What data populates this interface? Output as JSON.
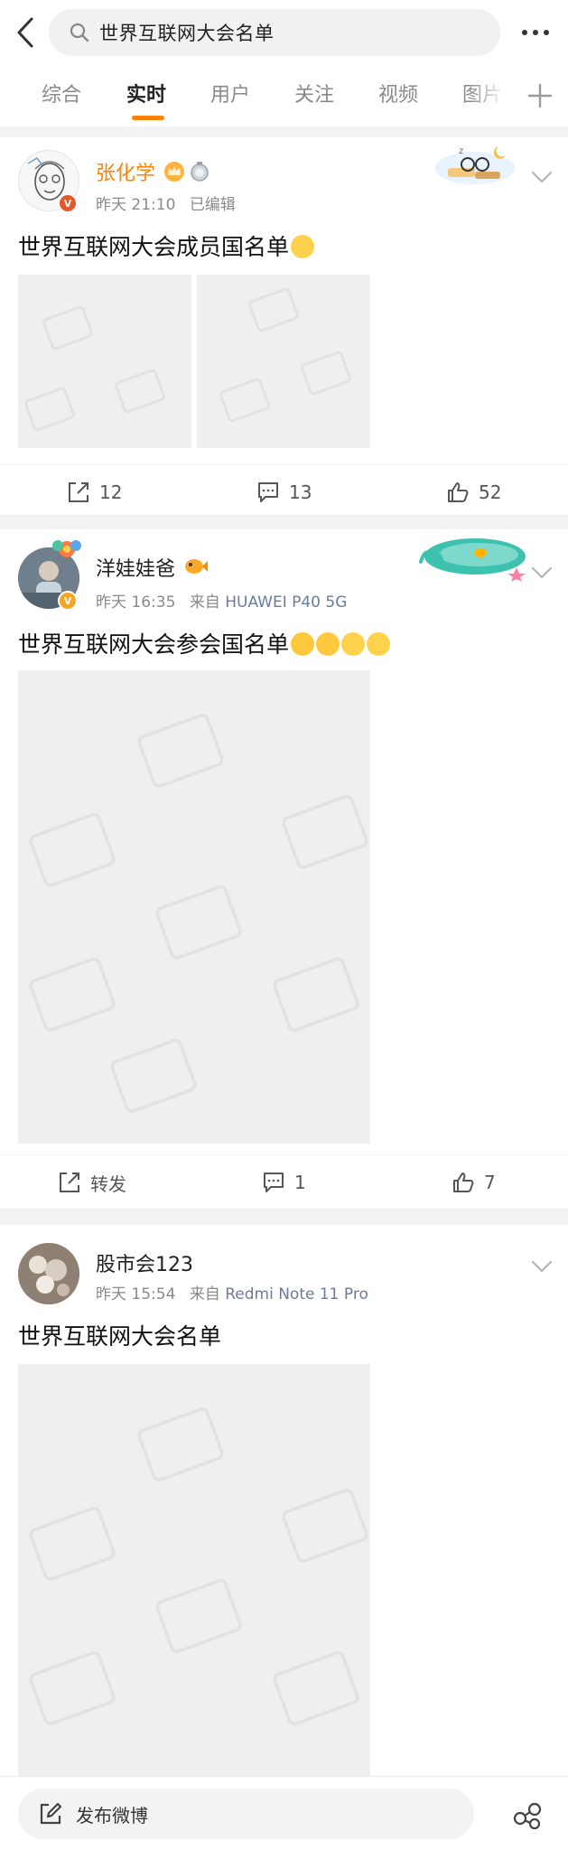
{
  "search": {
    "query": "世界互联网大会名单"
  },
  "tabs": [
    {
      "label": "综合"
    },
    {
      "label": "实时"
    },
    {
      "label": "用户"
    },
    {
      "label": "关注"
    },
    {
      "label": "视频"
    },
    {
      "label": "图片"
    }
  ],
  "posts": [
    {
      "author": "张化学",
      "time": "昨天 21:10",
      "edited_label": "已编辑",
      "text": "世界互联网大会成员国名单",
      "repost_count": "12",
      "comment_count": "13",
      "like_count": "52"
    },
    {
      "author": "洋娃娃爸",
      "time": "昨天 16:35",
      "source_prefix": "来自",
      "source": "HUAWEI P40 5G",
      "text": "世界互联网大会参会国名单",
      "repost_label": "转发",
      "comment_count": "1",
      "like_count": "7"
    },
    {
      "author": "股市会123",
      "time": "昨天 15:54",
      "source_prefix": "来自",
      "source": "Redmi Note 11 Pro",
      "text": "世界互联网大会名单"
    }
  ],
  "bottom": {
    "compose_label": "发布微博"
  },
  "colors": {
    "accent": "#ff8200",
    "verified": "#f5a623",
    "source_link": "#6a7c97"
  }
}
